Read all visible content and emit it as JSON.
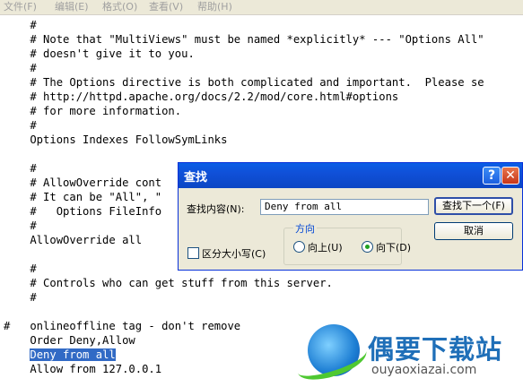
{
  "menu": [
    "文件(F)",
    "编辑(E)",
    "格式(O)",
    "查看(V)",
    "帮助(H)"
  ],
  "editor": {
    "lines": [
      "    #",
      "    # Note that \"MultiViews\" must be named *explicitly* --- \"Options All\"",
      "    # doesn't give it to you.",
      "    #",
      "    # The Options directive is both complicated and important.  Please se",
      "    # http://httpd.apache.org/docs/2.2/mod/core.html#options",
      "    # for more information.",
      "    #",
      "    Options Indexes FollowSymLinks",
      "",
      "    #",
      "    # AllowOverride cont",
      "    # It can be \"All\", \"",
      "    #   Options FileInfo",
      "    #",
      "    AllowOverride all",
      "",
      "    #",
      "    # Controls who can get stuff from this server.",
      "    #",
      "",
      "#   onlineoffline tag - don't remove",
      "    Order Deny,Allow",
      "",
      "    Allow from 127.0.0.1"
    ],
    "selected_line": "Deny from all"
  },
  "dialog": {
    "title": "查找",
    "help_glyph": "?",
    "close_glyph": "✕",
    "find_label": "查找内容(N):",
    "find_value": "Deny from all",
    "find_next_label": "查找下一个(F)",
    "cancel_label": "取消",
    "match_case_label": "区分大小写(C)",
    "match_case_checked": false,
    "direction_label": "方向",
    "up_label": "向上(U)",
    "down_label": "向下(D)",
    "direction_selected": "down"
  },
  "watermark": {
    "title": "偶要下载站",
    "url": "ouyaoxiazai.com"
  }
}
